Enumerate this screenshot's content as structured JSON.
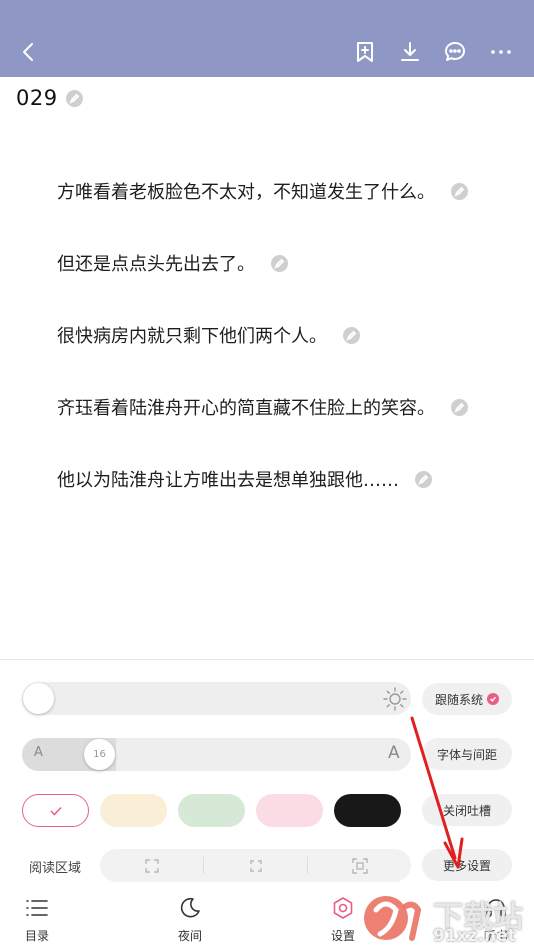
{
  "header": {
    "icons": [
      "back-icon",
      "bookmark-add-icon",
      "download-icon",
      "comment-icon",
      "more-icon"
    ]
  },
  "chapter": {
    "title": "029"
  },
  "paragraphs": [
    "方唯看着老板脸色不太对，不知道发生了什么。",
    "但还是点点头先出去了。",
    "很快病房内就只剩下他们两个人。",
    "齐珏看着陆淮舟开心的简直藏不住脸上的笑容。",
    "他以为陆淮舟让方唯出去是想单独跟他……"
  ],
  "settings": {
    "brightness_level": 0,
    "follow_system_label": "跟随系统",
    "follow_system_checked": true,
    "font_small_label": "A",
    "font_large_label": "A",
    "font_size_value": "16",
    "font_spacing_label": "字体与间距",
    "close_comments_label": "关闭吐槽",
    "more_settings_label": "更多设置",
    "reading_region_label": "阅读区域",
    "themes": [
      {
        "name": "white",
        "color": "#ffffff",
        "selected": true
      },
      {
        "name": "cream",
        "color": "#f9efd6",
        "selected": false
      },
      {
        "name": "green",
        "color": "#d6e8d6",
        "selected": false
      },
      {
        "name": "pink",
        "color": "#fcdce4",
        "selected": false
      },
      {
        "name": "black",
        "color": "#181818",
        "selected": false
      }
    ]
  },
  "tabs": [
    {
      "label": "目录",
      "icon": "list-icon",
      "active": false
    },
    {
      "label": "夜间",
      "icon": "moon-icon",
      "active": false
    },
    {
      "label": "设置",
      "icon": "gear-icon",
      "active": true
    },
    {
      "label": "听书",
      "icon": "headphones-icon",
      "active": false
    }
  ],
  "watermark": {
    "text": "下载站",
    "url": "91xz.net"
  },
  "colors": {
    "header_bg": "#8f98c4",
    "accent": "#e85f86",
    "arrow": "#e02020"
  }
}
